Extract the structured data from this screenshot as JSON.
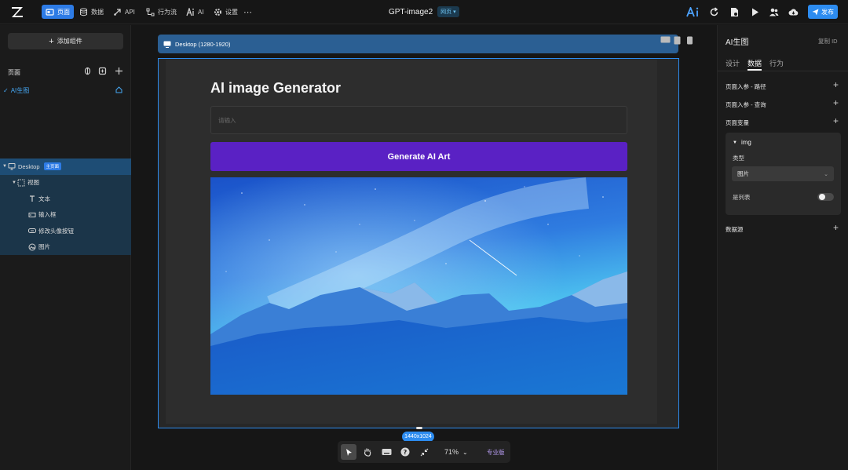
{
  "topbar": {
    "nav": [
      {
        "label": "页面",
        "icon": "page-icon",
        "active": true
      },
      {
        "label": "数据",
        "icon": "database-icon",
        "active": false
      },
      {
        "label": "API",
        "icon": "api-icon",
        "active": false
      },
      {
        "label": "行为流",
        "icon": "flow-icon",
        "active": false
      },
      {
        "label": "AI",
        "icon": "ai-icon",
        "active": false
      },
      {
        "label": "设置",
        "icon": "gear-icon",
        "active": false
      }
    ],
    "app_title": "GPT-image2",
    "mode_badge": "网页 ▾",
    "publish_label": "发布"
  },
  "left": {
    "add_component_label": "添加组件",
    "pages_heading": "页面",
    "page_item": "AI生图",
    "tree": [
      {
        "label": "Desktop",
        "badge": "主页面",
        "level": 0,
        "icon": "monitor-icon"
      },
      {
        "label": "视图",
        "level": 1,
        "icon": "view-icon"
      },
      {
        "label": "文本",
        "level": 2,
        "icon": "text-icon"
      },
      {
        "label": "输入框",
        "level": 2,
        "icon": "input-icon"
      },
      {
        "label": "修改头像按钮",
        "level": 2,
        "icon": "button-icon"
      },
      {
        "label": "图片",
        "level": 2,
        "icon": "image-icon"
      }
    ]
  },
  "canvas": {
    "frame_label": "Desktop (1280-1920)",
    "page_heading": "AI image Generator",
    "input_placeholder": "请输入",
    "generate_button": "Generate AI Art",
    "size_tag": "1440x1024",
    "zoom": "71%",
    "pro_label": "专业版"
  },
  "right": {
    "title": "AI生图",
    "copy_id": "复制 ID",
    "tabs": [
      "设计",
      "数据",
      "行为"
    ],
    "active_tab": "数据",
    "sections": {
      "route_params": "页面入参 - 路径",
      "query_params": "页面入参 - 查询",
      "page_vars": "页面变量",
      "data_source": "数据源"
    },
    "variable": {
      "name": "img",
      "type_label": "类型",
      "type_value": "图片",
      "is_list_label": "是列表",
      "is_list": false
    }
  },
  "colors": {
    "accent": "#2d8cf0",
    "generate_button": "#5a21c4",
    "selected_row": "#1e4d75"
  }
}
